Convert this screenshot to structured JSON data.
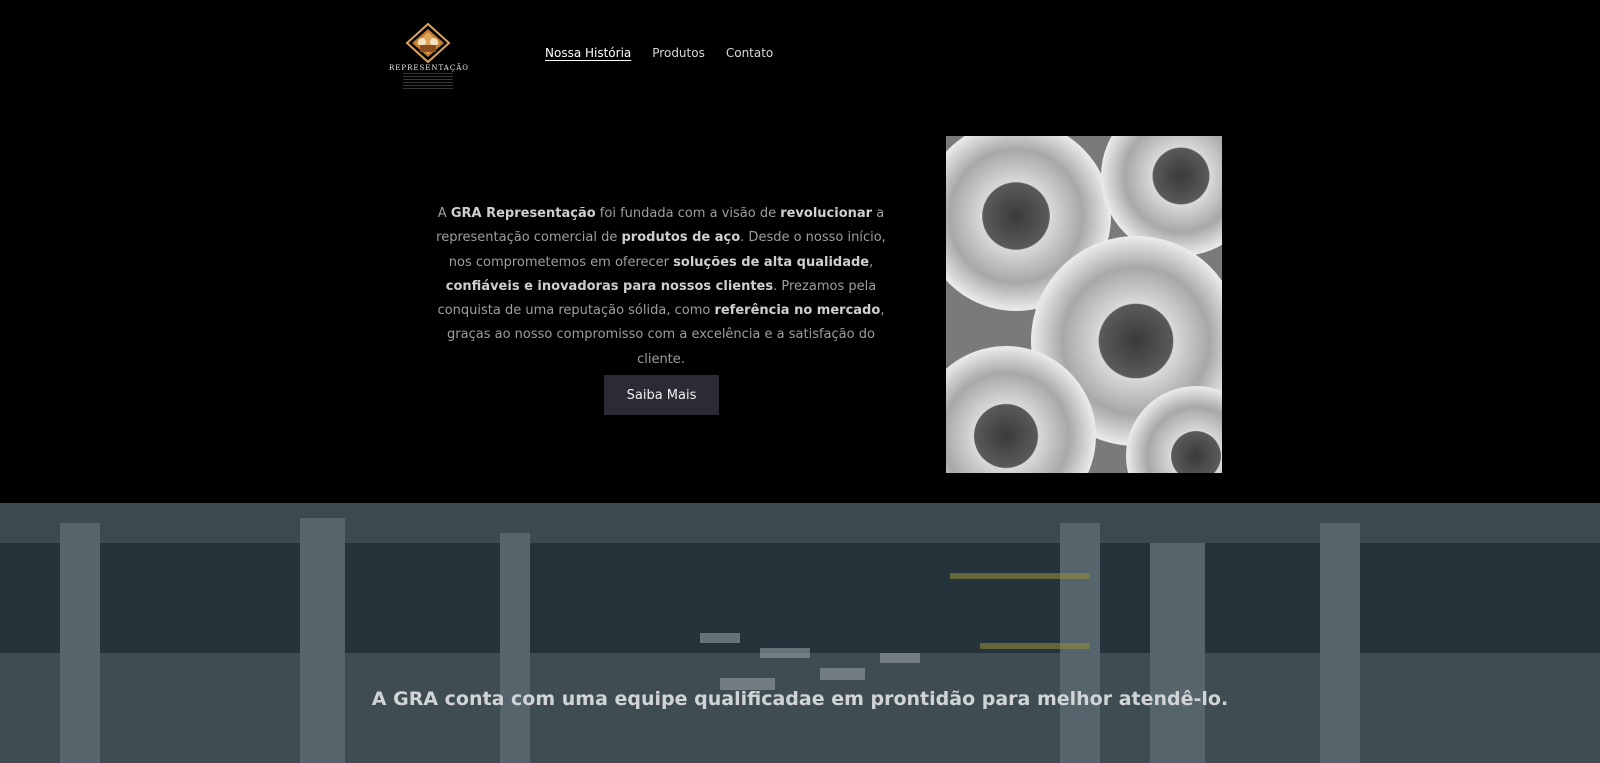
{
  "header": {
    "logo_text": "REPRESENTAÇÃO",
    "nav": [
      {
        "label": "Nossa História",
        "active": true
      },
      {
        "label": "Produtos",
        "active": false
      },
      {
        "label": "Contato",
        "active": false
      }
    ]
  },
  "hero": {
    "paragraph": [
      {
        "text": "A ",
        "bold": false
      },
      {
        "text": "GRA Representação",
        "bold": true
      },
      {
        "text": " foi fundada com a visão de ",
        "bold": false
      },
      {
        "text": "revolucionar",
        "bold": true
      },
      {
        "text": " a representação comercial de ",
        "bold": false
      },
      {
        "text": "produtos de aço",
        "bold": true
      },
      {
        "text": ". Desde o nosso início, nos comprometemos em oferecer ",
        "bold": false
      },
      {
        "text": "soluções de alta qualidade",
        "bold": true
      },
      {
        "text": ", ",
        "bold": false
      },
      {
        "text": "confiáveis e inovadoras para nossos clientes",
        "bold": true
      },
      {
        "text": ". Prezamos pela conquista de uma reputação sólida, como ",
        "bold": false
      },
      {
        "text": "referência no mercado",
        "bold": true
      },
      {
        "text": ", graças ao nosso compromisso com a excelência e a satisfação do cliente.",
        "bold": false
      }
    ],
    "cta_label": "Saiba Mais"
  },
  "team": {
    "tagline": "A GRA conta com uma equipe qualificadae em prontidão para melhor atendê-lo."
  },
  "colors": {
    "background": "#000000",
    "button": "#2a2b35",
    "warehouse_tint": "#2b3a40"
  }
}
